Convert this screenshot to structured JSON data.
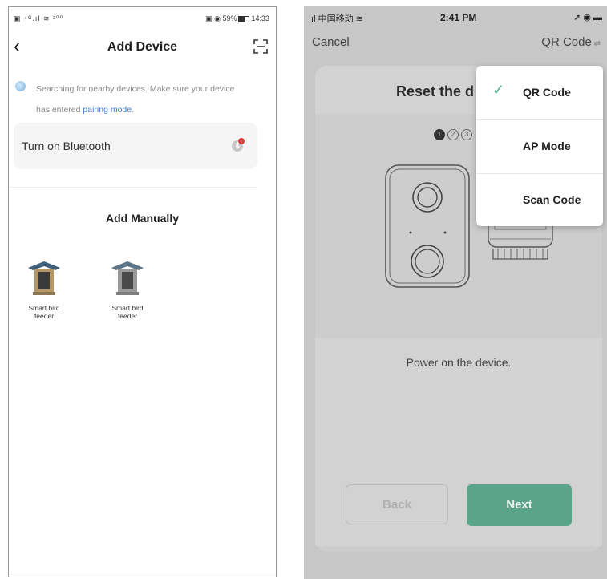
{
  "left": {
    "status": {
      "left": "▣ ⁴ᴳ.ıl ≋ ²⁰⁰",
      "right_icons": "▣ ◉ 59%",
      "time": "14:33"
    },
    "title": "Add Device",
    "search_text_1": "Searching for nearby devices. Make sure your device",
    "search_text_2": "has entered ",
    "search_link": "pairing mode",
    "search_text_end": ".",
    "bluetooth_label": "Turn on Bluetooth",
    "manual_title": "Add Manually",
    "devices": [
      {
        "line1": "Smart bird",
        "line2": "feeder"
      },
      {
        "line1": "Smart bird",
        "line2": "feeder"
      }
    ]
  },
  "right": {
    "status": {
      "left": ".ıl 中国移动 ≋",
      "time": "2:41 PM",
      "right": "➚ ◉ ▬"
    },
    "cancel": "Cancel",
    "qr_code": "QR Code",
    "qr_code_suffix": " ⇌",
    "reset_title": "Reset the d",
    "steps": [
      "1",
      "2",
      "3"
    ],
    "power_text": "Power on the device.",
    "back": "Back",
    "next": "Next",
    "menu": [
      "QR Code",
      "AP Mode",
      "Scan Code"
    ],
    "menu_check": "✓"
  },
  "colors": {
    "accent_green": "#5aa58a",
    "link_blue": "#3e7bd4",
    "badge_red": "#e03a3a"
  },
  "icons": [
    "back-chevron-icon",
    "scan-icon",
    "bluetooth-icon",
    "checkmark-icon"
  ]
}
